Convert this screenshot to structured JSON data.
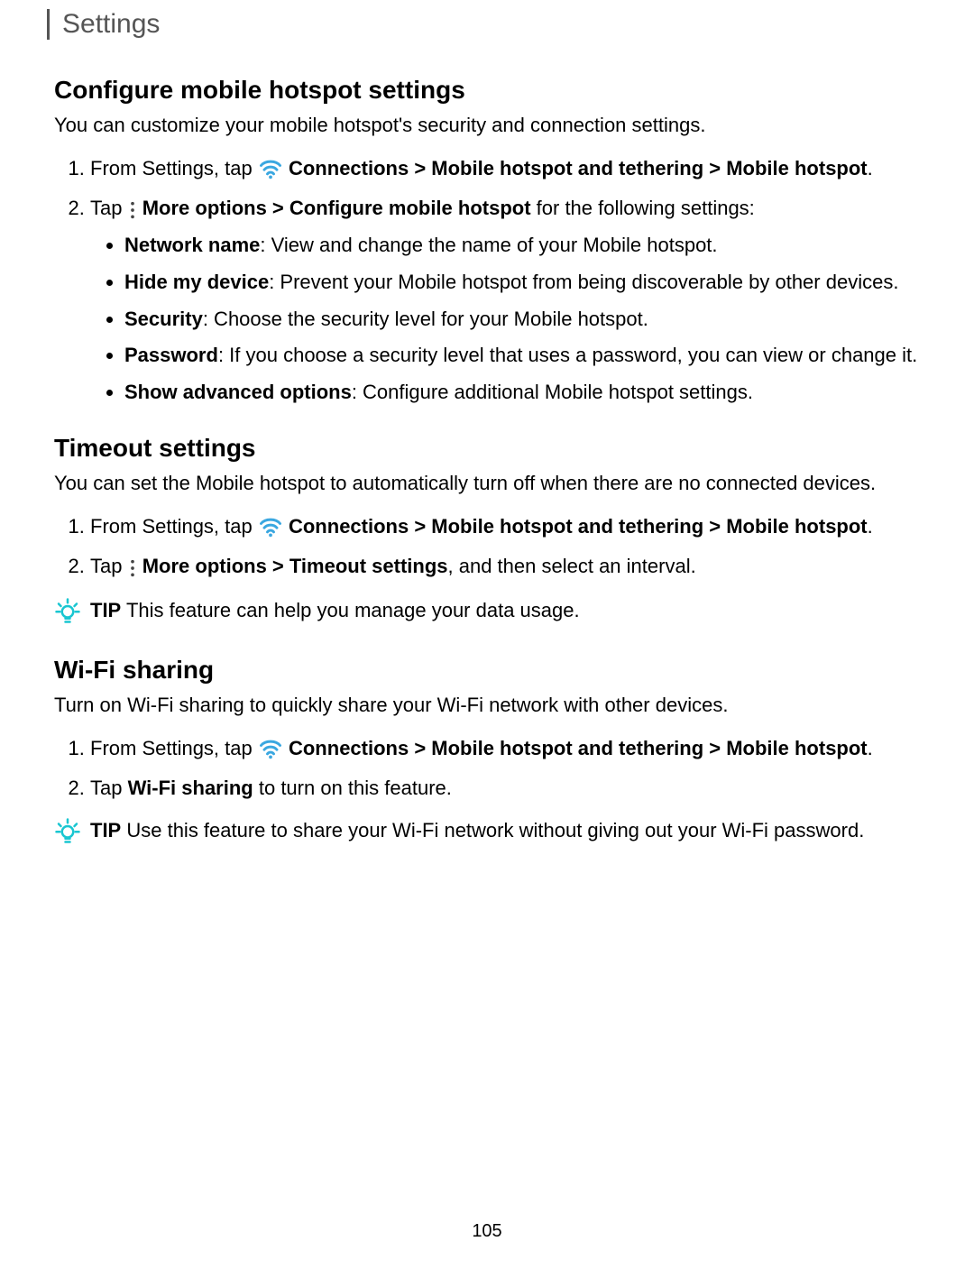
{
  "header": {
    "title": "Settings"
  },
  "section1": {
    "heading": "Configure mobile hotspot settings",
    "intro": "You can customize your mobile hotspot's security and connection settings.",
    "step1_pre": "From Settings, tap ",
    "step1_path": " Connections > Mobile hotspot and tethering > Mobile hotspot",
    "step1_end": ".",
    "step2_pre": "Tap ",
    "step2_path": " More options > Configure mobile hotspot",
    "step2_post": " for the following settings:",
    "bullets": {
      "b1_bold": "Network name",
      "b1_text": ": View and change the name of your Mobile hotspot.",
      "b2_bold": "Hide my device",
      "b2_text": ": Prevent your Mobile hotspot from being discoverable by other devices.",
      "b3_bold": "Security",
      "b3_text": ": Choose the security level for your Mobile hotspot.",
      "b4_bold": "Password",
      "b4_text": ": If you choose a security level that uses a password, you can view or change it.",
      "b5_bold": "Show advanced options",
      "b5_text": ": Configure additional Mobile hotspot settings."
    }
  },
  "section2": {
    "heading": "Timeout settings",
    "intro": "You can set the Mobile hotspot to automatically turn off when there are no connected devices.",
    "step1_pre": "From Settings, tap ",
    "step1_path": " Connections > Mobile hotspot and tethering > Mobile hotspot",
    "step1_end": ".",
    "step2_pre": "Tap ",
    "step2_path": " More options > Timeout settings",
    "step2_post": ", and then select an interval.",
    "tip_label": "TIP",
    "tip_text": "  This feature can help you manage your data usage."
  },
  "section3": {
    "heading": "Wi-Fi sharing",
    "intro": "Turn on Wi-Fi sharing to quickly share your Wi-Fi network with other devices.",
    "step1_pre": "From Settings, tap ",
    "step1_path": " Connections > Mobile hotspot and tethering > Mobile hotspot",
    "step1_end": ".",
    "step2_pre": "Tap ",
    "step2_bold": "Wi-Fi sharing",
    "step2_post": " to turn on this feature.",
    "tip_label": "TIP",
    "tip_text": "  Use this feature to share your Wi-Fi network without giving out your Wi-Fi password."
  },
  "page_number": "105"
}
